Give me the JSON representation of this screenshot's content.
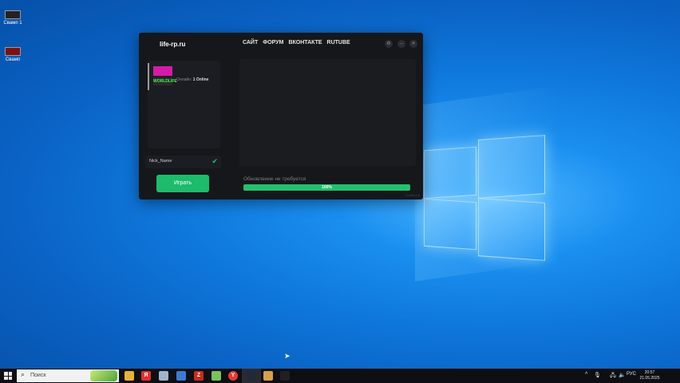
{
  "desktop": {
    "icons": [
      {
        "label": "Свамп 1"
      },
      {
        "label": "Свамп"
      }
    ]
  },
  "launcher": {
    "site": "life-rp.ru",
    "nav": [
      "САЙТ",
      "ФОРУМ",
      "ВКОНТАКТЕ",
      "RUTUBE"
    ],
    "server": {
      "logo_text": "WORLDLIFE",
      "online_label": "Онлайн:",
      "online_value": "1 Online"
    },
    "nickname": "Nick_Name",
    "play_label": "Играть",
    "update_status": "Обновление не требуется",
    "progress": {
      "value_percent": 100,
      "label": "100%"
    },
    "version": "0.4.81.1.0"
  },
  "taskbar": {
    "search_placeholder": "Поиск",
    "apps": [
      {
        "icon": "file-explorer-icon",
        "color": "#e8b23a"
      },
      {
        "icon": "yandex-icon",
        "color": "#e03030",
        "glyph": "Я"
      },
      {
        "icon": "cloud-icon",
        "color": "#9fb4c8"
      },
      {
        "icon": "virtualbox-icon",
        "color": "#3b7bd6"
      },
      {
        "icon": "filezilla-icon",
        "color": "#c92a1e",
        "glyph": "Z"
      },
      {
        "icon": "notepad-icon",
        "color": "#79c25c"
      },
      {
        "icon": "yandex-browser-icon",
        "color": "#ffffff",
        "glyph": "Y"
      },
      {
        "icon": "launcher-icon",
        "color": "#1e2a38"
      },
      {
        "icon": "photo-icon",
        "color": "#d6a04a"
      },
      {
        "icon": "obs-icon",
        "color": "#202020"
      }
    ],
    "language": "РУС",
    "time": "20:57",
    "date": "21.05.2025"
  },
  "colors": {
    "accent": "#1dbb6c",
    "window_bg": "#16171b",
    "server_logo_pink": "#d81aa8"
  }
}
